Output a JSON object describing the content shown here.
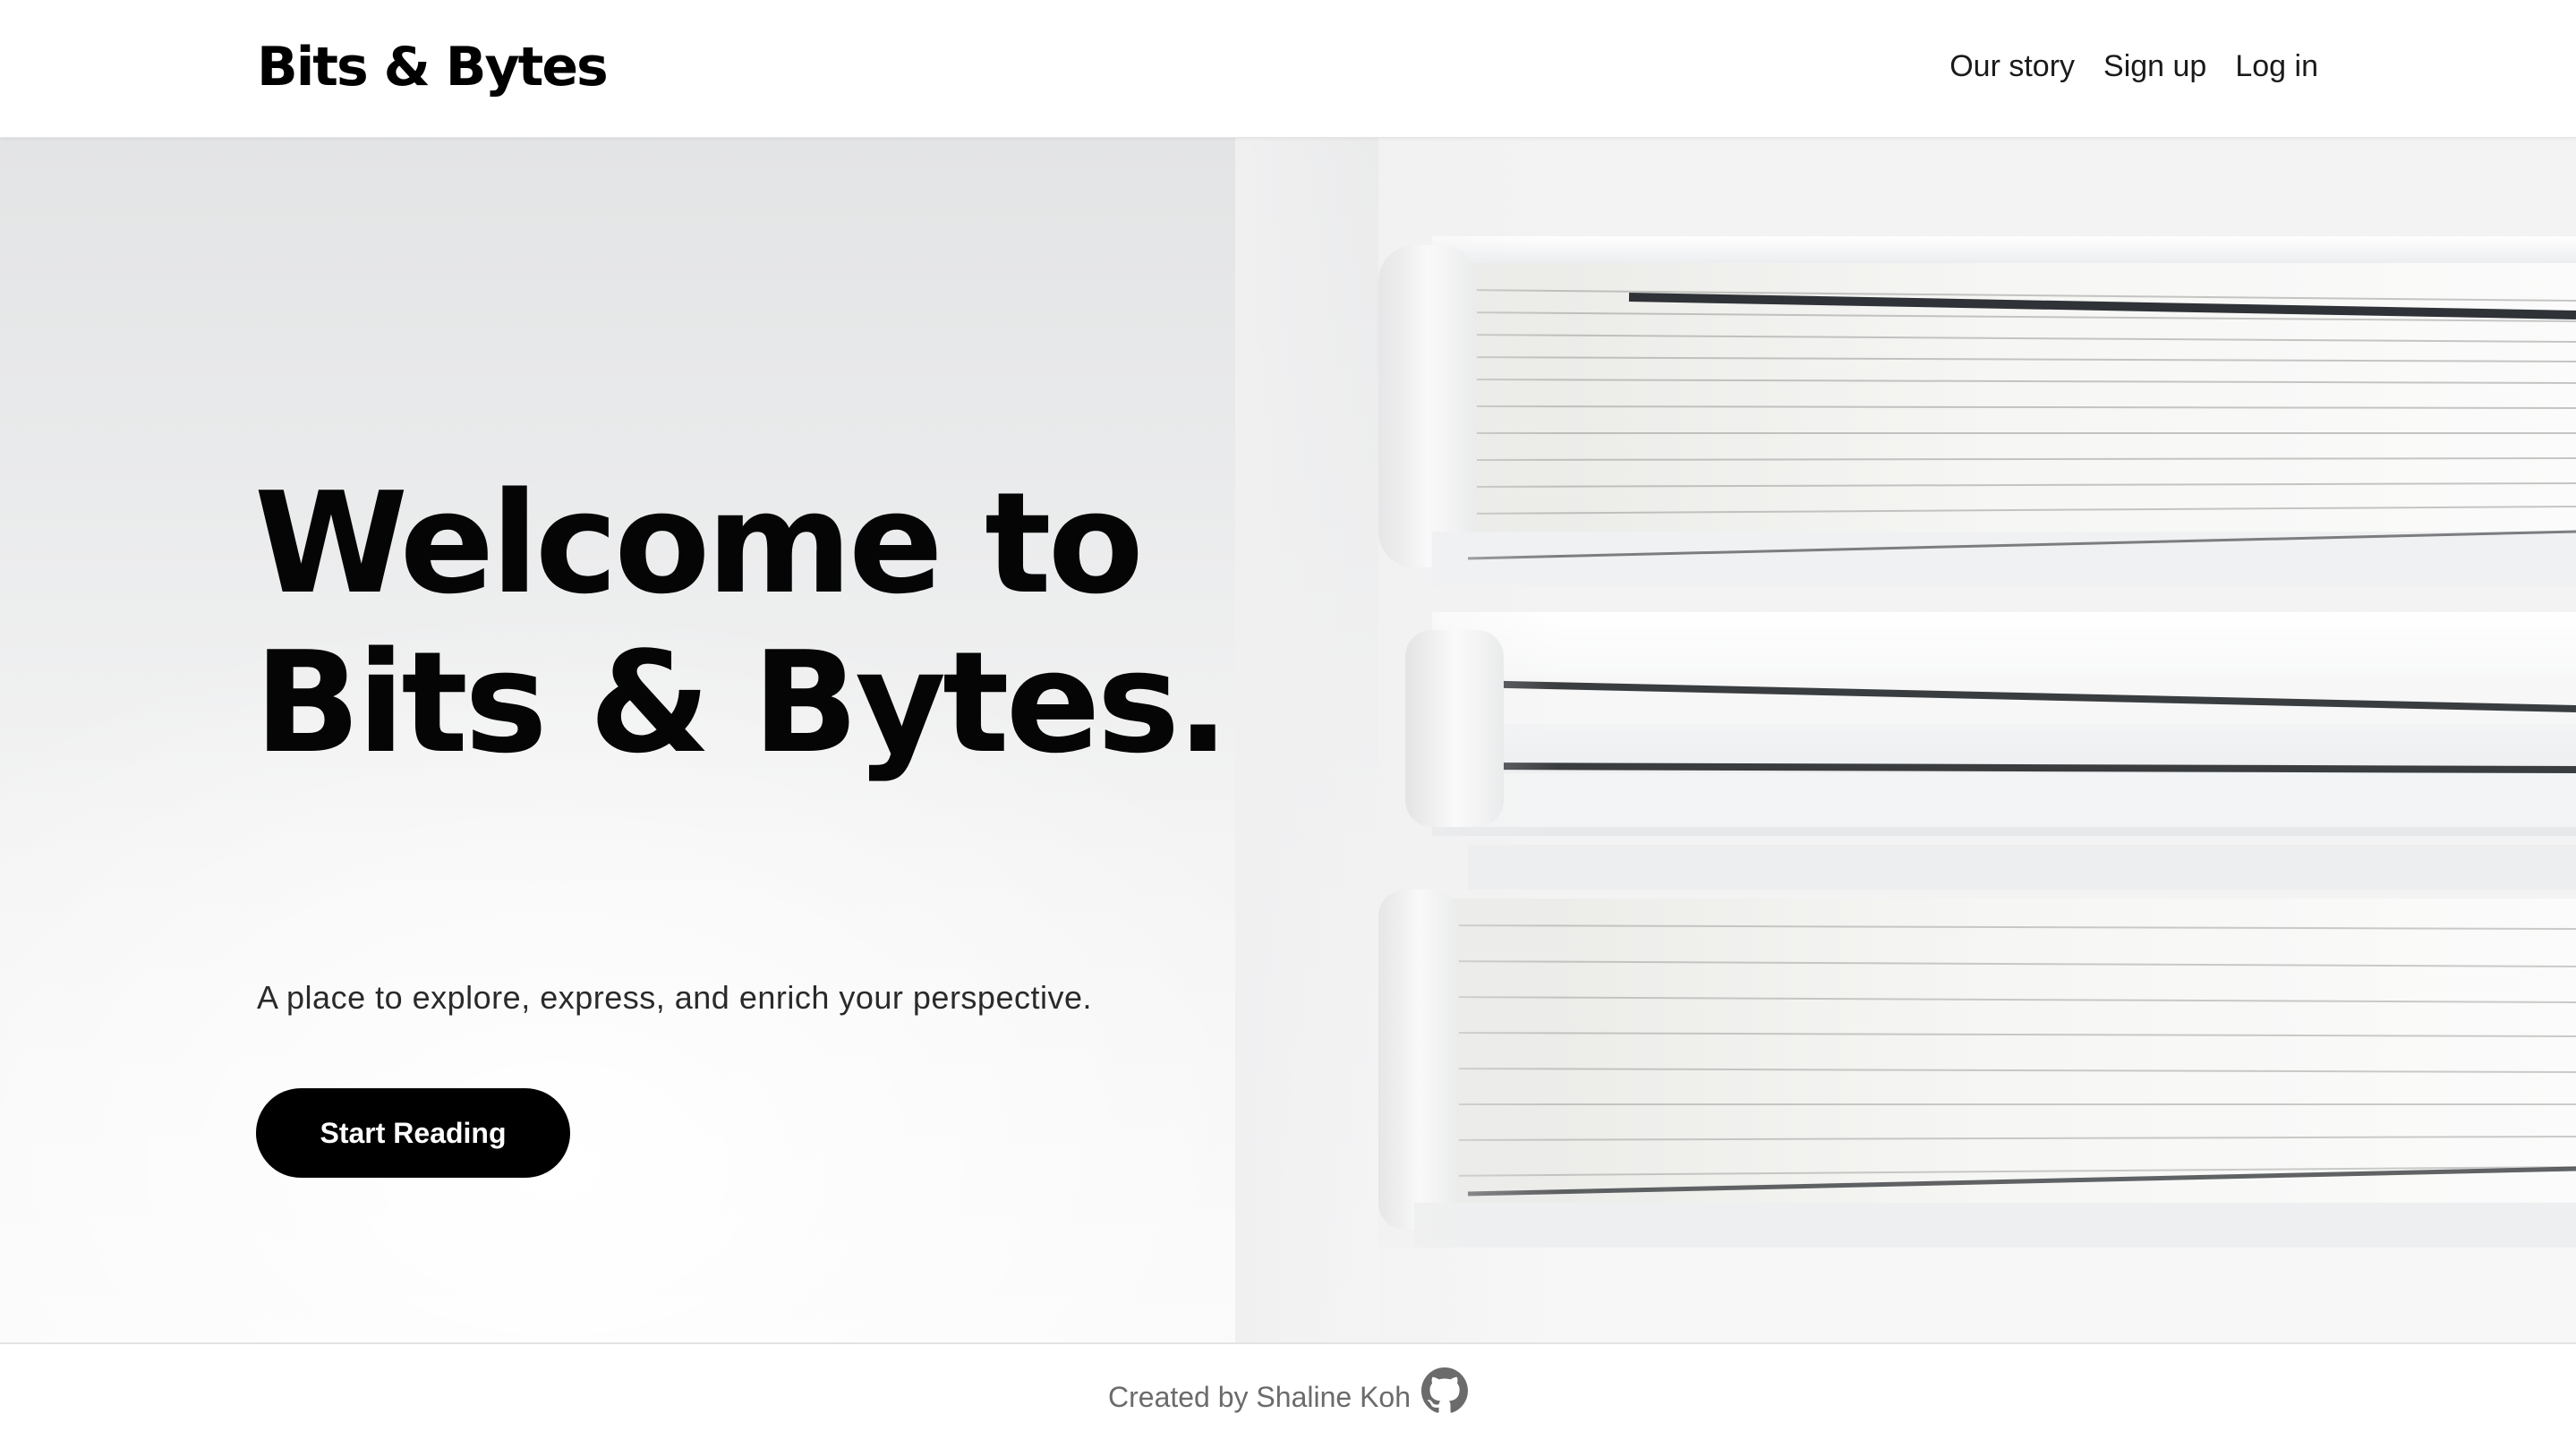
{
  "header": {
    "brand": "Bits & Bytes",
    "nav": [
      {
        "label": "Our story"
      },
      {
        "label": "Sign up"
      },
      {
        "label": "Log in"
      }
    ]
  },
  "hero": {
    "title_line1": "Welcome to",
    "title_line2": "Bits & Bytes.",
    "subtitle": "A place to explore, express, and enrich your perspective.",
    "cta_label": "Start Reading",
    "image": "stack-of-white-books"
  },
  "footer": {
    "credit": "Created by Shaline Koh",
    "icon": "github-icon"
  },
  "colors": {
    "primary": "#000000",
    "background": "#ffffff",
    "muted_text": "#6b6b6b"
  }
}
